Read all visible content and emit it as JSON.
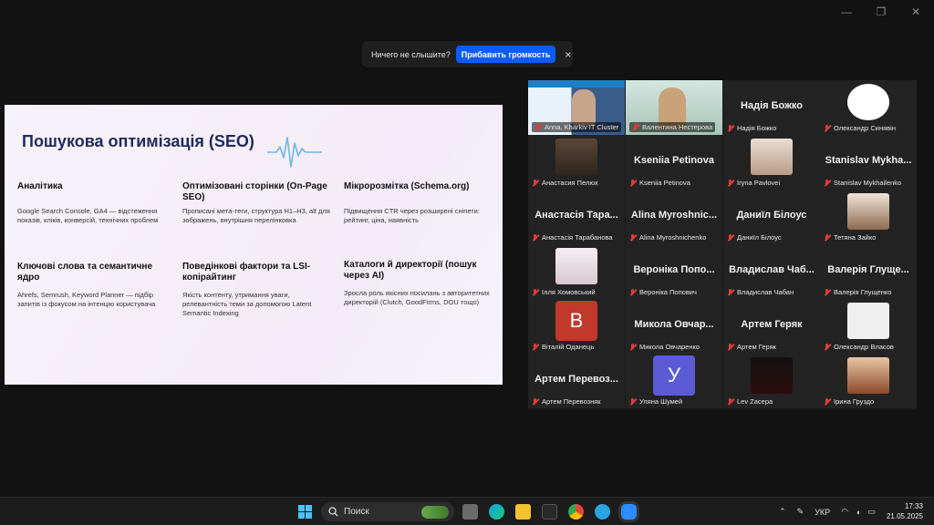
{
  "window": {
    "controls": [
      "—",
      "❐",
      "✕"
    ]
  },
  "banner": {
    "text": "Ничего не слышите?",
    "button": "Прибавить громкость",
    "close": "×"
  },
  "slide": {
    "title": "Пошукова оптимізація (SEO)",
    "sections": [
      {
        "title": "Аналітика",
        "desc": "Google Search Console, GA4 — відстеження показів, кліків, конверсій, технічних проблем"
      },
      {
        "title": "Оптимізовані сторінки (On-Page SEO)",
        "desc": "Прописані мета-теги, структура H1–H3, alt для зображень, внутрішня перелінковка"
      },
      {
        "title": "Мікророзмітка (Schema.org)",
        "desc": "Підвищення CTR через розширені сніпети: рейтинг, ціна, наявність"
      },
      {
        "title": "Ключові слова та семантичне ядро",
        "desc": "Ahrefs, Semrush, Keyword Planner — підбір запитів із фокусом на інтенцію користувача"
      },
      {
        "title": "Поведінкові фактори та LSI-копірайтинг",
        "desc": "Якість контенту, утримання уваги, релевантність теми за допомогою Latent Semantic Indexing"
      },
      {
        "title": "Каталоги й директорії (пошук через AI)",
        "desc": "Зросла роль якісних посилань з авторитетних директорій (Clutch, GoodFirms, DOU тощо)"
      }
    ]
  },
  "participants": [
    {
      "label": "Anna, Kharkiv IT Cluster",
      "big": "",
      "type": "video"
    },
    {
      "label": "Валентина Нестерова",
      "big": "",
      "type": "video"
    },
    {
      "label": "Надія Божко",
      "big": "Надія Божко",
      "type": "name"
    },
    {
      "label": "Олександр Синявін",
      "big": "",
      "type": "photo"
    },
    {
      "label": "Анастасия Пелюх",
      "big": "",
      "type": "photo"
    },
    {
      "label": "Kseniia Petinova",
      "big": "Kseniia Petinova",
      "type": "name"
    },
    {
      "label": "Iryna Pavlovei",
      "big": "",
      "type": "photo"
    },
    {
      "label": "Stanislav Mykhailenko",
      "big": "Stanislav  Mykha...",
      "type": "name"
    },
    {
      "label": "Анастасія Тарабанова",
      "big": "Анастасія  Тара...",
      "type": "name"
    },
    {
      "label": "Alina Myroshnichenko",
      "big": "Alina  Myroshnic...",
      "type": "name"
    },
    {
      "label": "Даниїл Білоус",
      "big": "Даниїл Білоус",
      "type": "name"
    },
    {
      "label": "Тетяна Зайко",
      "big": "",
      "type": "photo"
    },
    {
      "label": "Ілля Хомовський",
      "big": "",
      "type": "photo"
    },
    {
      "label": "Вероніка Попович",
      "big": "Вероніка  Попо...",
      "type": "name"
    },
    {
      "label": "Владислав Чабан",
      "big": "Владислав  Чаб...",
      "type": "name"
    },
    {
      "label": "Валерія Глущенко",
      "big": "Валерія  Глуще...",
      "type": "name"
    },
    {
      "label": "Віталій Оданець",
      "big": "B",
      "type": "letter"
    },
    {
      "label": "Микола Овчаренко",
      "big": "Микола  Овчар...",
      "type": "name"
    },
    {
      "label": "Артем Геряк",
      "big": "Артем Геряк",
      "type": "name"
    },
    {
      "label": "Олександр Власов",
      "big": "",
      "type": "photo"
    },
    {
      "label": "Артем Перевозняк",
      "big": "Артем  Перевоз...",
      "type": "name"
    },
    {
      "label": "Уляна Шумей",
      "big": "У",
      "type": "letter"
    },
    {
      "label": "Lev Zacepa",
      "big": "",
      "type": "photo"
    },
    {
      "label": "Ірина Груздо",
      "big": "",
      "type": "photo"
    }
  ],
  "colors": {
    "accent": "#0b5cff",
    "muted_red": "#e23b3b",
    "active_speaker": "#2ecc40",
    "letter_b": "#c0392b",
    "letter_u": "#5b5bd6"
  },
  "taskbar": {
    "search_placeholder": "Поиск",
    "lang": "УКР",
    "time": "17:33",
    "date": "21.05.2025"
  }
}
